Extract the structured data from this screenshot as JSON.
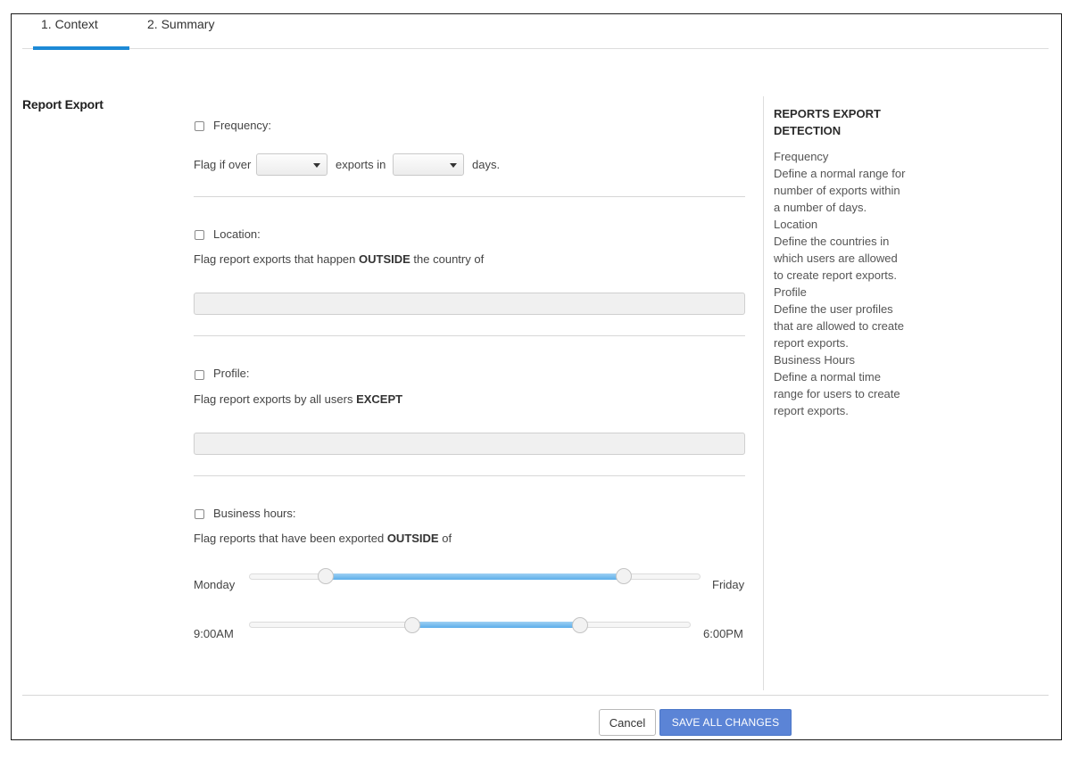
{
  "tabs": [
    {
      "label": "1. Context",
      "active": true
    },
    {
      "label": "2. Summary",
      "active": false
    }
  ],
  "section": {
    "title": "Report Export"
  },
  "frequency": {
    "label": "Frequency:",
    "checked": false,
    "flag_prefix": "Flag if over",
    "exports_value": "",
    "exports_in": "exports in",
    "days_value": "",
    "days_suffix": "days."
  },
  "location": {
    "label": "Location:",
    "checked": false,
    "desc_prefix": "Flag report exports that happen ",
    "desc_bold": "OUTSIDE",
    "desc_suffix": " the country of",
    "value": ""
  },
  "profile": {
    "label": "Profile:",
    "checked": false,
    "desc_prefix": "Flag report exports by all users ",
    "desc_bold": "EXCEPT",
    "value": ""
  },
  "business_hours": {
    "label": "Business hours:",
    "checked": false,
    "desc_prefix": "Flag reports that have been exported ",
    "desc_bold": "OUTSIDE",
    "desc_suffix": " of",
    "day_min_label": "Monday",
    "day_max_label": "Friday",
    "day_range": [
      0.17,
      0.83
    ],
    "time_min_label": "9:00AM",
    "time_max_label": "6:00PM",
    "time_range": [
      0.37,
      0.75
    ]
  },
  "help": {
    "title": "REPORTS EXPORT DETECTION",
    "lines": [
      "Frequency",
      "Define a normal range for",
      "number of exports within",
      "a number of days.",
      "Location",
      "Define the countries in",
      "which users are allowed",
      "to create report exports.",
      "Profile",
      "Define the user profiles",
      "that are allowed to create",
      "report exports.",
      "Business Hours",
      "Define a normal time",
      "range for users to create",
      "report exports."
    ]
  },
  "footer": {
    "cancel_label": "Cancel",
    "save_label": "SAVE ALL CHANGES"
  },
  "colors": {
    "tab_accent": "#1d8ad6",
    "slider_fill": "#5baeea",
    "primary_button": "#5b84d6"
  }
}
